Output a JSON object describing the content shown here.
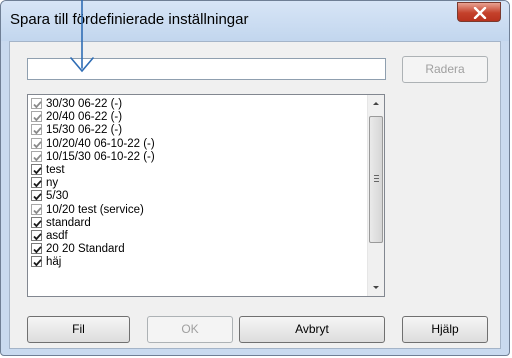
{
  "window": {
    "title": "Spara till fördefinierade inställningar",
    "close_label": "Close"
  },
  "name_input": {
    "value": "",
    "placeholder": ""
  },
  "buttons": {
    "delete_label": "Radera",
    "file_label": "Fil",
    "ok_label": "OK",
    "cancel_label": "Avbryt",
    "help_label": "Hjälp"
  },
  "presets": [
    {
      "label": "30/30 06-22 (-)",
      "checked": true,
      "grayed": true
    },
    {
      "label": "20/40 06-22 (-)",
      "checked": true,
      "grayed": true
    },
    {
      "label": "15/30 06-22 (-)",
      "checked": true,
      "grayed": true
    },
    {
      "label": "10/20/40 06-10-22 (-)",
      "checked": true,
      "grayed": true
    },
    {
      "label": "10/15/30 06-10-22 (-)",
      "checked": true,
      "grayed": true
    },
    {
      "label": "test",
      "checked": true,
      "grayed": false
    },
    {
      "label": "ny",
      "checked": true,
      "grayed": false
    },
    {
      "label": "5/30",
      "checked": true,
      "grayed": false
    },
    {
      "label": "10/20 test (service)",
      "checked": true,
      "grayed": true
    },
    {
      "label": "standard",
      "checked": true,
      "grayed": false
    },
    {
      "label": "asdf",
      "checked": true,
      "grayed": false
    },
    {
      "label": "20 20 Standard",
      "checked": true,
      "grayed": false
    },
    {
      "label": "häj",
      "checked": true,
      "grayed": false
    }
  ],
  "colors": {
    "annotation_arrow": "#2f6db5",
    "check_dark": "#1a1a1a",
    "check_gray": "#8a8a8a"
  },
  "icons": {
    "close": "close-x-icon",
    "annotation": "arrow-pointer-icon",
    "scroll_up": "scroll-up-arrow-icon",
    "scroll_down": "scroll-down-arrow-icon"
  }
}
